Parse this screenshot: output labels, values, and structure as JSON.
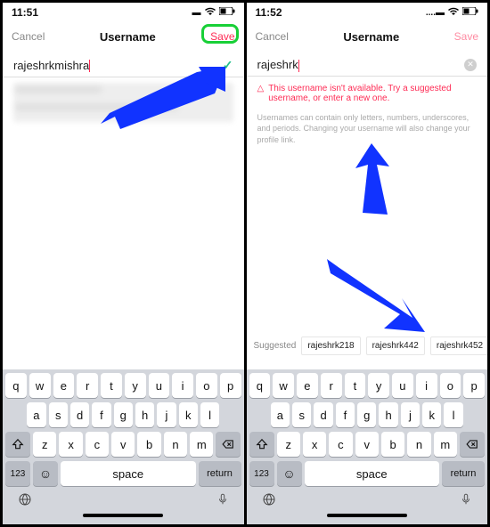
{
  "left": {
    "status": {
      "time": "11:51"
    },
    "nav": {
      "cancel": "Cancel",
      "title": "Username",
      "save": "Save"
    },
    "input": {
      "value": "rajeshrkmishra"
    },
    "keyboard": {
      "row1": [
        "q",
        "w",
        "e",
        "r",
        "t",
        "y",
        "u",
        "i",
        "o",
        "p"
      ],
      "row2": [
        "a",
        "s",
        "d",
        "f",
        "g",
        "h",
        "j",
        "k",
        "l"
      ],
      "row3": [
        "z",
        "x",
        "c",
        "v",
        "b",
        "n",
        "m"
      ],
      "numkey": "123",
      "space": "space",
      "ret": "return"
    }
  },
  "right": {
    "status": {
      "time": "11:52"
    },
    "nav": {
      "cancel": "Cancel",
      "title": "Username",
      "save": "Save"
    },
    "input": {
      "value": "rajeshrk"
    },
    "error": "This username isn't available. Try a suggested username, or enter a new one.",
    "hint": "Usernames can contain only letters, numbers, underscores, and periods. Changing your username will also change your profile link.",
    "suggest_label": "Suggested",
    "suggestions": [
      "rajeshrk218",
      "rajeshrk442",
      "rajeshrk452"
    ],
    "keyboard": {
      "row1": [
        "q",
        "w",
        "e",
        "r",
        "t",
        "y",
        "u",
        "i",
        "o",
        "p"
      ],
      "row2": [
        "a",
        "s",
        "d",
        "f",
        "g",
        "h",
        "j",
        "k",
        "l"
      ],
      "row3": [
        "z",
        "x",
        "c",
        "v",
        "b",
        "n",
        "m"
      ],
      "numkey": "123",
      "space": "space",
      "ret": "return"
    }
  }
}
